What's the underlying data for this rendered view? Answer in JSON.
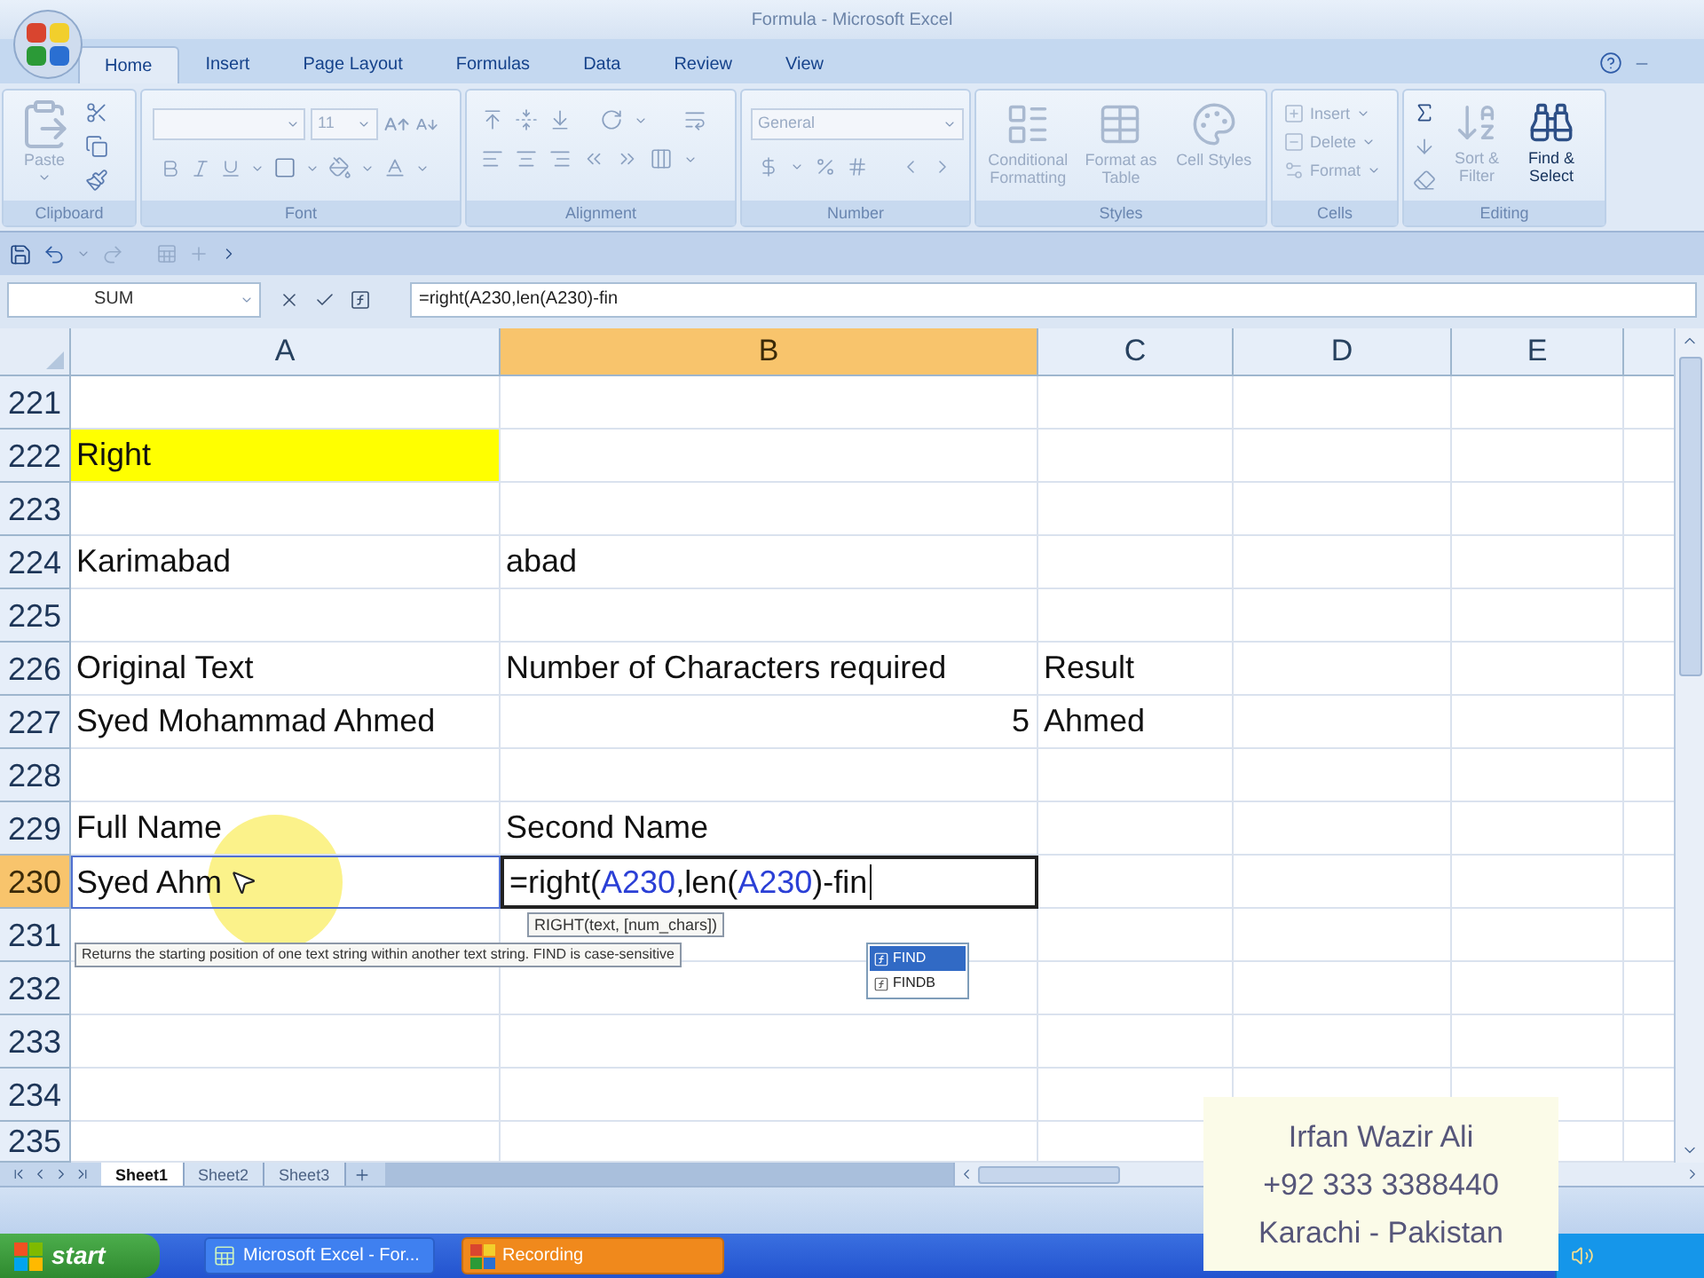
{
  "window": {
    "title": "Formula - Microsoft Excel"
  },
  "ribbon": {
    "tabs": [
      {
        "label": "Home",
        "selected": true
      },
      {
        "label": "Insert",
        "selected": false
      },
      {
        "label": "Page Layout",
        "selected": false
      },
      {
        "label": "Formulas",
        "selected": false
      },
      {
        "label": "Data",
        "selected": false
      },
      {
        "label": "Review",
        "selected": false
      },
      {
        "label": "View",
        "selected": false
      }
    ],
    "groups": [
      {
        "kind": "clipboard",
        "label": "Clipboard",
        "buttons": [
          {
            "label": "Paste",
            "disabled": true
          }
        ]
      },
      {
        "kind": "font",
        "label": "Font",
        "font_size": "11"
      },
      {
        "kind": "alignment",
        "label": "Alignment"
      },
      {
        "kind": "number",
        "label": "Number",
        "format": "General"
      },
      {
        "kind": "styles",
        "label": "Styles",
        "buttons": [
          {
            "label": "Conditional Formatting",
            "disabled": true
          },
          {
            "label": "Format as Table",
            "disabled": true
          },
          {
            "label": "Cell Styles",
            "disabled": true
          }
        ]
      },
      {
        "kind": "cells",
        "label": "Cells",
        "buttons": [
          {
            "label": "Insert",
            "disabled": true
          },
          {
            "label": "Delete",
            "disabled": true
          },
          {
            "label": "Format",
            "disabled": true
          }
        ]
      },
      {
        "kind": "editing",
        "label": "Editing",
        "buttons": [
          {
            "label": "Sort & Filter",
            "disabled": true
          },
          {
            "label": "Find & Select",
            "disabled": false
          }
        ]
      }
    ]
  },
  "formula_bar": {
    "name_box": "SUM",
    "formula": "=right(A230,len(A230)-fin"
  },
  "sheet": {
    "columns": [
      {
        "label": "A",
        "selected": false
      },
      {
        "label": "B",
        "selected": true
      },
      {
        "label": "C",
        "selected": false
      },
      {
        "label": "D",
        "selected": false
      },
      {
        "label": "E",
        "selected": false
      }
    ],
    "rows": [
      {
        "header": "221",
        "selected": false
      },
      {
        "header": "222",
        "selected": false,
        "a": {
          "kind": "text",
          "text": "Right",
          "color": "#ffff00"
        }
      },
      {
        "header": "223",
        "selected": false
      },
      {
        "header": "224",
        "selected": false,
        "a": {
          "kind": "text",
          "text": "Karimabad"
        },
        "b": {
          "kind": "text",
          "text": "abad"
        }
      },
      {
        "header": "225",
        "selected": false
      },
      {
        "header": "226",
        "selected": false,
        "a": {
          "kind": "text",
          "text": "Original Text"
        },
        "b": {
          "kind": "text",
          "text": "Number of Characters required"
        },
        "c": {
          "kind": "text",
          "text": "Result"
        }
      },
      {
        "header": "227",
        "selected": false,
        "a": {
          "kind": "text",
          "text": "Syed Mohammad Ahmed"
        },
        "b": {
          "kind": "number",
          "text": "5"
        },
        "c": {
          "kind": "text",
          "text": "Ahmed"
        }
      },
      {
        "header": "228",
        "selected": false
      },
      {
        "header": "229",
        "selected": false,
        "a": {
          "kind": "text",
          "text": "Full Name"
        },
        "b": {
          "kind": "text",
          "text": "Second Name"
        }
      },
      {
        "header": "230",
        "selected": true,
        "a": {
          "kind": "reference",
          "text": "Syed Ahm"
        },
        "b": {
          "kind": "formula",
          "parts": [
            {
              "kind": "plain",
              "text": "=right("
            },
            {
              "kind": "ref",
              "text": "A230"
            },
            {
              "kind": "plain",
              "text": ",len("
            },
            {
              "kind": "ref",
              "text": "A230"
            },
            {
              "kind": "plain",
              "text": ")-fin"
            }
          ]
        }
      },
      {
        "header": "231",
        "selected": false
      },
      {
        "header": "232",
        "selected": false
      },
      {
        "header": "233",
        "selected": false
      },
      {
        "header": "234",
        "selected": false
      },
      {
        "header": "235",
        "selected": false
      }
    ]
  },
  "editing": {
    "argument_tip": "RIGHT(text, [num_chars])",
    "description_tip": "Returns the starting position of one text string within another text string. FIND is case-sensitive",
    "suggestions": [
      {
        "label": "FIND",
        "selected": true
      },
      {
        "label": "FINDB",
        "selected": false
      }
    ]
  },
  "sheet_tabs": [
    {
      "label": "Sheet1",
      "selected": true
    },
    {
      "label": "Sheet2",
      "selected": false
    },
    {
      "label": "Sheet3",
      "selected": false
    }
  ],
  "taskbar": {
    "start": "start",
    "buttons": [
      {
        "label": "Microsoft Excel - For...",
        "kind": "window"
      },
      {
        "label": "Recording",
        "kind": "flashing"
      }
    ]
  },
  "caption": {
    "lines": [
      "Irfan Wazir Ali",
      "+92 333 3388440",
      "Karachi - Pakistan"
    ]
  }
}
